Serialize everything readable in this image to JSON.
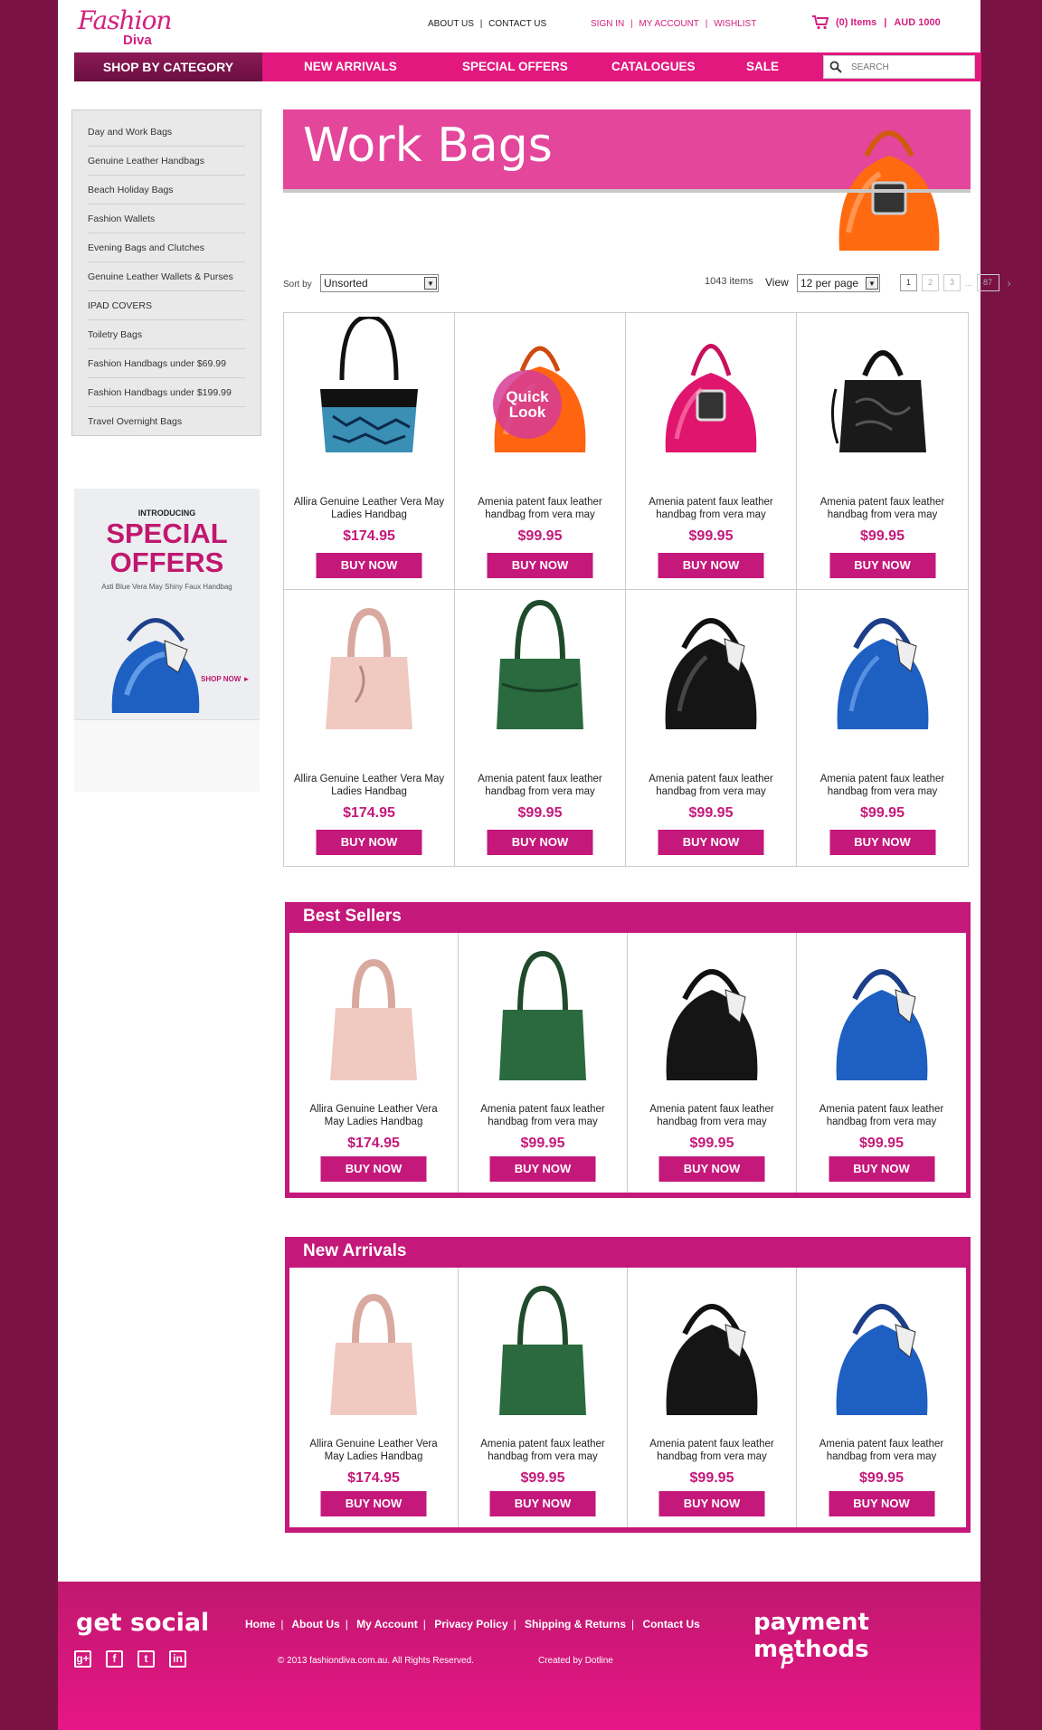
{
  "brand": {
    "logo_top": "Fashion",
    "logo_bottom": "Diva"
  },
  "header": {
    "about": "ABOUT US",
    "contact": "CONTACT US",
    "sign_in": "SIGN IN",
    "my_account": "MY ACCOUNT",
    "wishlist": "WISHLIST",
    "sep": "|",
    "cart_items": "(0) Items",
    "cart_total": "AUD 1000"
  },
  "nav": {
    "category": "SHOP BY CATEGORY",
    "items": [
      "NEW ARRIVALS",
      "SPECIAL OFFERS",
      "CATALOGUES",
      "SALE"
    ],
    "search_placeholder": "SEARCH"
  },
  "sidebar": {
    "items": [
      "Day and Work Bags",
      "Genuine Leather Handbags",
      "Beach Holiday Bags",
      "Fashion Wallets",
      "Evening Bags and Clutches",
      "Genuine Leather Wallets & Purses",
      "IPAD COVERS",
      "Toiletry Bags",
      "Fashion Handbags under $69.99",
      "Fashion Handbags under $199.99",
      "Travel Overnight Bags"
    ]
  },
  "promo": {
    "intro": "INTRODUCING",
    "title_line1": "SPECIAL",
    "title_line2": "OFFERS",
    "subtitle": "Asti Blue Vera May Shiny Faux Handbag",
    "cta": "SHOP NOW ►"
  },
  "banner": {
    "title": "Work Bags"
  },
  "listing": {
    "sort_label": "Sort by",
    "sort_value": "Unsorted",
    "count": "1043 items",
    "view_label": "View",
    "per_page": "12 per page",
    "pages": [
      "1",
      "2",
      "3",
      "...",
      "87"
    ],
    "next": "›"
  },
  "quick_look": "Quick Look",
  "buy_label": "BUY NOW",
  "products": [
    {
      "name": "Allira Genuine Leather Vera May Ladies Handbag",
      "price": "$174.95",
      "icon": "blue-croc-bag"
    },
    {
      "name": "Amenia patent faux leather handbag from vera may",
      "price": "$99.95",
      "icon": "orange-patent-bag"
    },
    {
      "name": "Amenia patent faux leather handbag from vera may",
      "price": "$99.95",
      "icon": "pink-patent-bag"
    },
    {
      "name": "Amenia patent faux leather handbag from vera may",
      "price": "$99.95",
      "icon": "black-embossed-bag"
    },
    {
      "name": "Allira Genuine Leather Vera May Ladies Handbag",
      "price": "$174.95",
      "icon": "blush-pink-bag"
    },
    {
      "name": "Amenia patent faux leather handbag from vera may",
      "price": "$99.95",
      "icon": "green-leather-bag"
    },
    {
      "name": "Amenia patent faux leather handbag from vera may",
      "price": "$99.95",
      "icon": "black-patent-scarf-bag"
    },
    {
      "name": "Amenia patent faux leather handbag from vera may",
      "price": "$99.95",
      "icon": "blue-patent-scarf-bag"
    }
  ],
  "best_sellers": {
    "title": "Best Sellers",
    "items": [
      {
        "name": "Allira Genuine Leather Vera May Ladies Handbag",
        "price": "$174.95"
      },
      {
        "name": "Amenia patent faux leather handbag from vera may",
        "price": "$99.95"
      },
      {
        "name": "Amenia patent faux leather handbag from vera may",
        "price": "$99.95"
      },
      {
        "name": "Amenia patent faux leather handbag from vera may",
        "price": "$99.95"
      }
    ]
  },
  "new_arrivals": {
    "title": "New Arrivals",
    "items": [
      {
        "name": "Allira Genuine Leather Vera May Ladies Handbag",
        "price": "$174.95"
      },
      {
        "name": "Amenia patent faux leather handbag from vera may",
        "price": "$99.95"
      },
      {
        "name": "Amenia patent faux leather handbag from vera may",
        "price": "$99.95"
      },
      {
        "name": "Amenia patent faux leather handbag from vera may",
        "price": "$99.95"
      }
    ]
  },
  "footer": {
    "get_social": "get social",
    "payment_methods": "payment methods",
    "links": [
      "Home",
      "About Us",
      "My Account",
      "Privacy Policy",
      "Shipping & Returns",
      "Contact Us"
    ],
    "copyright": "© 2013 fashiondiva.com.au. All Rights Reserved.",
    "credit": "Created by Dotline",
    "social_icons": [
      "google-plus-icon",
      "facebook-icon",
      "twitter-icon",
      "linkedin-icon"
    ],
    "payment_icon": "paypal-icon"
  },
  "colors": {
    "accent": "#e2187f",
    "brand_dark": "#c4187a",
    "outer_bg": "#7a1244"
  }
}
